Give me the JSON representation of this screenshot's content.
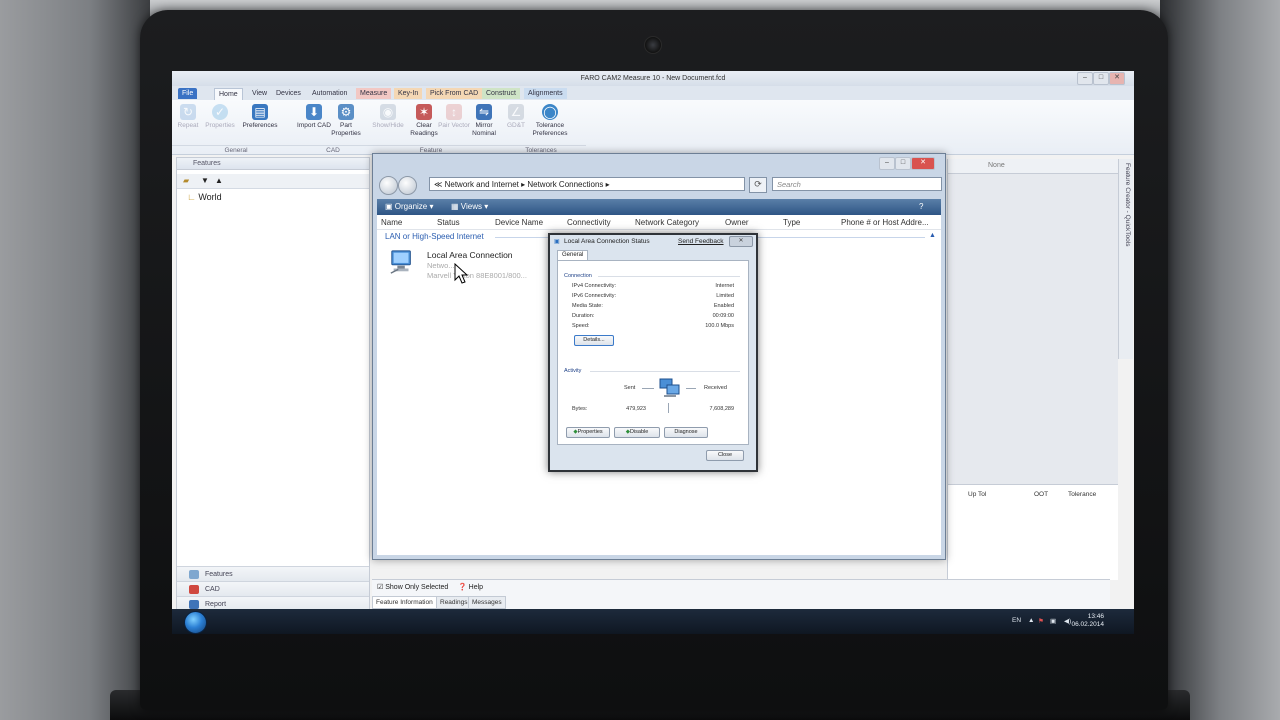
{
  "app": {
    "title": "FARO CAM2 Measure 10 - New Document.fcd",
    "ribbon_tabs": [
      {
        "label": "File"
      },
      {
        "label": "Home"
      },
      {
        "label": "View"
      },
      {
        "label": "Devices"
      },
      {
        "label": "Automation"
      },
      {
        "label": "Measure"
      },
      {
        "label": "Key-In"
      },
      {
        "label": "Pick From CAD"
      },
      {
        "label": "Construct"
      },
      {
        "label": "Alignments"
      }
    ],
    "ribbon_buttons": [
      {
        "label": "Repeat",
        "icon": "repeat-icon"
      },
      {
        "label": "Properties",
        "icon": "check-circle-icon"
      },
      {
        "label": "Preferences",
        "icon": "preferences-icon"
      },
      {
        "label": "Import CAD",
        "icon": "import-cad-icon"
      },
      {
        "label": "Part Properties",
        "icon": "part-properties-icon"
      },
      {
        "label": "Show/Hide",
        "icon": "show-hide-icon"
      },
      {
        "label": "Clear Readings",
        "icon": "clear-readings-icon"
      },
      {
        "label": "Pair Vector",
        "icon": "pair-vector-icon"
      },
      {
        "label": "Mirror Nominal",
        "icon": "mirror-nominal-icon"
      },
      {
        "label": "GD&T",
        "icon": "gdt-icon"
      },
      {
        "label": "Tolerance Preferences",
        "icon": "tolerance-icon"
      }
    ],
    "ribbon_groups": [
      "General",
      "CAD",
      "Feature",
      "Tolerances"
    ]
  },
  "left_panel": {
    "header": "Features",
    "tree_root": "World",
    "nav": [
      "Features",
      "CAD",
      "Report"
    ]
  },
  "right_panel": {
    "filter_value": "None",
    "side_tab": "Feature Creator - QuickTools",
    "table_headers": [
      "Up Tol",
      "OOT",
      "Tolerance"
    ]
  },
  "bottom": {
    "show_only_selected": "Show Only Selected",
    "help": "Help",
    "tabs": [
      "Feature Information",
      "Readings",
      "Messages"
    ]
  },
  "explorer": {
    "breadcrumb": [
      "Network and Internet",
      "Network Connections"
    ],
    "search_placeholder": "Search",
    "commands": {
      "organize": "Organize",
      "views": "Views"
    },
    "columns": [
      "Name",
      "Status",
      "Device Name",
      "Connectivity",
      "Network Category",
      "Owner",
      "Type",
      "Phone # or Host Addre..."
    ],
    "group": "LAN or High-Speed Internet",
    "connection": {
      "name": "Local Area Connection",
      "sub1": "Netwo...",
      "sub2": "Marvell Yukon 88E8001/800..."
    }
  },
  "dialog": {
    "title": "Local Area Connection Status",
    "send_feedback": "Send Feedback",
    "tab": "General",
    "connection_header": "Connection",
    "rows": [
      {
        "label": "IPv4 Connectivity:",
        "value": "Internet"
      },
      {
        "label": "IPv6 Connectivity:",
        "value": "Limited"
      },
      {
        "label": "Media State:",
        "value": "Enabled"
      },
      {
        "label": "Duration:",
        "value": "00:09:00"
      },
      {
        "label": "Speed:",
        "value": "100.0 Mbps"
      }
    ],
    "details": "Details...",
    "activity_header": "Activity",
    "sent_label": "Sent",
    "received_label": "Received",
    "bytes_label": "Bytes:",
    "bytes_sent": "479,923",
    "bytes_received": "7,608,289",
    "buttons": {
      "properties": "Properties",
      "disable": "Disable",
      "diagnose": "Diagnose",
      "close": "Close"
    }
  },
  "taskbar": {
    "lang": "EN",
    "time": "13:46",
    "date": "06.02.2014"
  },
  "colors": {
    "ribbon_file": "#3a72c4",
    "explorer_cmdbar": "#2e5585",
    "link_blue": "#2a5db0"
  }
}
